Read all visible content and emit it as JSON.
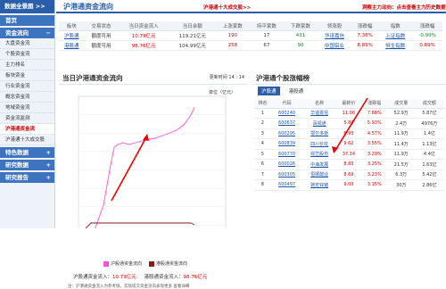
{
  "sidebar": {
    "header": "数据全景图 >>",
    "sections": [
      {
        "label": "首页"
      },
      {
        "label": "资金流向"
      }
    ],
    "items": [
      "大盘资金流",
      "个股资金流",
      "主力排名",
      "板块资金",
      "行业资金流",
      "概念资金流",
      "地域资金流",
      "资金流监测",
      "沪港通资金流",
      "沪港通十大成交股"
    ],
    "bottom_sections": [
      "特色数据",
      "研究数据",
      "研究报告"
    ]
  },
  "header": {
    "title": "沪港通资金流向",
    "link1": "沪港通十大成交股>>",
    "link2": "洞察主力动向：点击查看主力历史数据"
  },
  "top_table": {
    "headers": [
      "板块",
      "交易状态",
      "当日资金流入",
      "当日余额",
      "上涨家数",
      "持平家数",
      "下跌家数",
      "领涨股",
      "涨跌幅",
      "指数",
      "涨跌幅"
    ],
    "rows": [
      [
        "沪股通",
        "额度可用",
        "10.79亿元",
        "119.21亿元",
        "190",
        "17",
        "431",
        "华谊嘉信",
        "7.38%",
        "上证指数",
        "-0.99%"
      ],
      [
        "港股通",
        "额度可用",
        "98.76亿元",
        "104.99亿元",
        "258",
        "67",
        "90",
        "中国铝业",
        "8.89%",
        "恒生指数",
        "0.89%"
      ]
    ]
  },
  "left_panel": {
    "title": "当日沪港通资金流向",
    "time_label": "更新时间",
    "time_value": "14 : 14",
    "unit": "单位（亿元）",
    "x_ticks": [
      "9:02",
      "11:30",
      "14:28",
      "15:57"
    ],
    "legend1": "沪股通资金流向",
    "legend2": "港股通资金流向",
    "foot_label1": "沪股通资金流入：",
    "foot_val1": "10.79亿元",
    "foot_label2": "港股通资金流入：",
    "foot_val2": "98.76亿元",
    "note": "注：沪港通资金流入为参考值，实际成交资金流向表现更多  查看详细",
    "colors": {
      "sh": "#ff4fd8",
      "hk": "#8b1a1a"
    }
  },
  "right_panel": {
    "title": "沪港通个股涨幅榜",
    "tabs": [
      "沪股通",
      "港股通"
    ],
    "headers": [
      "排名",
      "代码",
      "名称",
      "最新价",
      "涨跌幅",
      "成交量",
      "成交额"
    ],
    "rows": [
      [
        "1",
        "600240",
        "华谊嘉信",
        "11.06",
        "7.68%",
        "52.9万",
        "5.87亿"
      ],
      [
        "2",
        "600637",
        "百视通",
        "5.80",
        "5.93%",
        "2.4万",
        "4976万"
      ],
      [
        "3",
        "600295",
        "鄂尔多斯",
        "8.93",
        "4.57%",
        "11.9万",
        "1.4亿"
      ],
      [
        "4",
        "600839",
        "四川长虹",
        "9.62",
        "3.55%",
        "11.4万",
        "1.13亿"
      ],
      [
        "5",
        "600770",
        "综艺股份",
        "37.34",
        "3.29%",
        "11.9万",
        "4.4亿"
      ],
      [
        "6",
        "600026",
        "中海发展",
        "8.83",
        "3.25%",
        "21.5万",
        "1.63亿"
      ],
      [
        "7",
        "600305",
        "恒顺醋业",
        "8.69",
        "3.23%",
        "6.3万",
        "5.42亿"
      ],
      [
        "8",
        "600497",
        "驰宏锌锗",
        "9.03",
        "3.15%",
        "30万",
        "2.86亿"
      ]
    ]
  }
}
